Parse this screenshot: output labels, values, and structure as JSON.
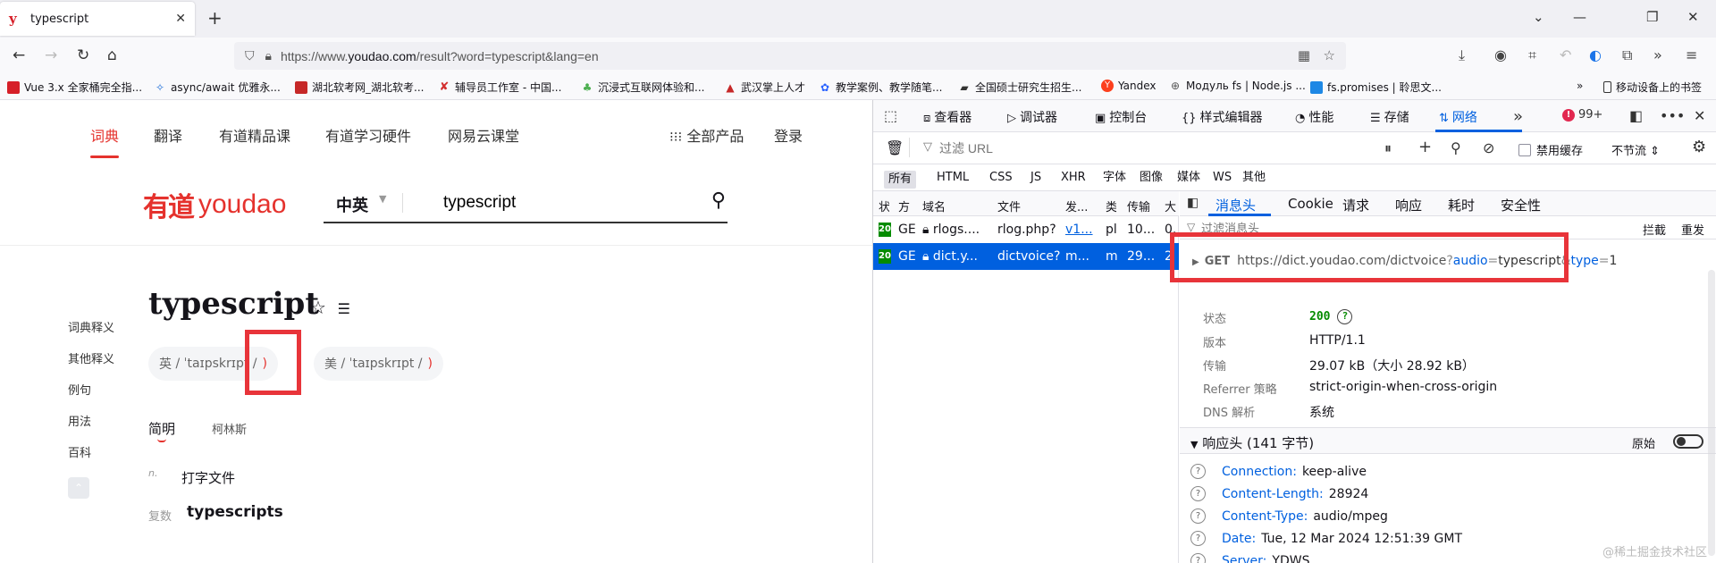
{
  "browser": {
    "tab_title": "typescript",
    "tab_favicon": "y",
    "url_prefix": "https://www.",
    "url_domain": "youdao.com",
    "url_rest": "/result?word=typescript&lang=en",
    "bookmarks": [
      "Vue 3.x 全家桶完全指...",
      "async/await 优雅永...",
      "湖北软考网_湖北软考...",
      "辅导员工作室 - 中国...",
      "沉浸式互联网体验和...",
      "武汉掌上人才",
      "教学案例、教学随笔...",
      "全国硕士研究生招生...",
      "Yandex",
      "Модуль fs | Node.js ...",
      "fs.promises | 聆思文...",
      "移动设备上的书签"
    ]
  },
  "youdao": {
    "nav": [
      "词典",
      "翻译",
      "有道精品课",
      "有道学习硬件",
      "网易云课堂",
      "全部产品",
      "登录"
    ],
    "logo_cn": "有道",
    "logo_en": "youdao",
    "search_lang": "中英",
    "search_value": "typescript",
    "word": "typescript",
    "phonetic_uk_label": "英",
    "phonetic_uk": "/ ˈtaɪpskrɪpt /",
    "phonetic_us_label": "美",
    "phonetic_us": "/ ˈtaɪpskrɪpt /",
    "side_nav": [
      "词典释义",
      "其他释义",
      "例句",
      "用法",
      "百科"
    ],
    "dict_tabs": [
      "简明",
      "柯林斯"
    ],
    "pos": "n.",
    "definition": "打字文件",
    "plural_label": "复数",
    "plural": "typescripts"
  },
  "devtools": {
    "tabs": [
      "查看器",
      "调试器",
      "控制台",
      "样式编辑器",
      "性能",
      "存储",
      "网络"
    ],
    "error_count": "99+",
    "filter_placeholder": "过滤 URL",
    "disable_cache": "禁用缓存",
    "throttle": "不节流 ⇕",
    "type_filters": [
      "所有",
      "HTML",
      "CSS",
      "JS",
      "XHR",
      "字体",
      "图像",
      "媒体",
      "WS",
      "其他"
    ],
    "columns": [
      "状",
      "方",
      "域名",
      "文件",
      "发...",
      "类",
      "传输",
      "大"
    ],
    "requests": [
      {
        "status": "200",
        "method": "GE",
        "domain": "rlogs....",
        "file": "rlog.php?",
        "initiator": "v1...",
        "type": "pl",
        "transfer": "10...",
        "size": "0."
      },
      {
        "status": "200",
        "method": "GE",
        "domain": "dict.y...",
        "file": "dictvoice?",
        "initiator": "m...",
        "type": "m",
        "transfer": "29...",
        "size": "2"
      }
    ],
    "detail_tabs": [
      "消息头",
      "Cookie",
      "请求",
      "响应",
      "耗时",
      "安全性"
    ],
    "header_filter_placeholder": "过滤消息头",
    "block_label": "拦截",
    "resend_label": "重发",
    "request": {
      "method": "GET",
      "base": "https://dict.youdao.com/dictvoice",
      "q": "?",
      "k1": "audio",
      "eq": "=",
      "v1": "typescript",
      "amp": "&",
      "k2": "type",
      "v2": "1"
    },
    "summary": [
      {
        "key": "状态",
        "value": "200"
      },
      {
        "key": "版本",
        "value": "HTTP/1.1"
      },
      {
        "key": "传输",
        "value": "29.07 kB（大小 28.92 kB）"
      },
      {
        "key": "Referrer 策略",
        "value": "strict-origin-when-cross-origin"
      },
      {
        "key": "DNS 解析",
        "value": "系统"
      }
    ],
    "response_headers_title": "响应头 (141 字节)",
    "raw_label": "原始",
    "response_headers": [
      {
        "key": "Connection:",
        "value": "keep-alive"
      },
      {
        "key": "Content-Length:",
        "value": "28924"
      },
      {
        "key": "Content-Type:",
        "value": "audio/mpeg"
      },
      {
        "key": "Date:",
        "value": "Tue, 12 Mar 2024 12:51:39 GMT"
      },
      {
        "key": "Server:",
        "value": "YDWS"
      }
    ]
  },
  "watermark": "@稀土掘金技术社区",
  "colors": {
    "accent": "#0060df",
    "brand": "#e5322d",
    "annotation": "#e8343a",
    "ok": "#058b00"
  }
}
